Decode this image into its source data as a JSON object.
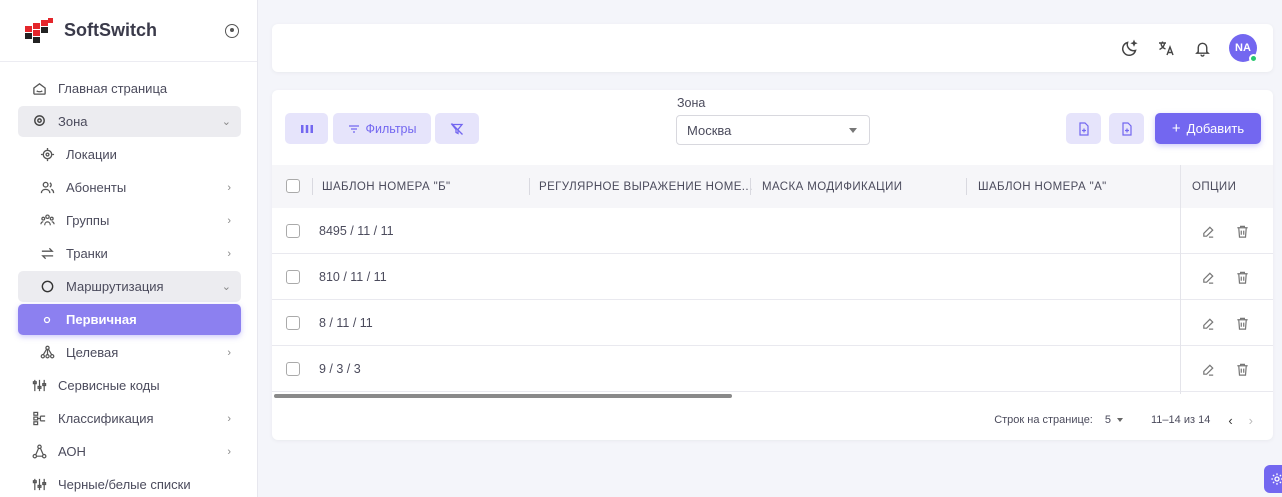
{
  "brand": {
    "name": "SoftSwitch"
  },
  "sidebar": {
    "items": [
      {
        "label": "Главная страница",
        "icon": "home-icon"
      },
      {
        "label": "Зона",
        "icon": "location-pin-icon",
        "expanded": true
      },
      {
        "label": "Локации",
        "icon": "target-icon"
      },
      {
        "label": "Абоненты",
        "icon": "users-icon"
      },
      {
        "label": "Группы",
        "icon": "group-icon"
      },
      {
        "label": "Транки",
        "icon": "arrows-exchange-icon"
      },
      {
        "label": "Маршрутизация",
        "icon": "circle-icon",
        "expanded": true
      },
      {
        "label": "Первичная",
        "icon": "dot-icon",
        "active": true
      },
      {
        "label": "Целевая",
        "icon": "sitemap-icon"
      },
      {
        "label": "Сервисные коды",
        "icon": "sliders-icon"
      },
      {
        "label": "Классификация",
        "icon": "hierarchy-icon"
      },
      {
        "label": "АОН",
        "icon": "network-icon"
      },
      {
        "label": "Черные/белые списки",
        "icon": "sliders-icon"
      }
    ]
  },
  "topbar": {
    "avatar_initials": "NA",
    "accent": "#7367f0",
    "online_color": "#28c76f"
  },
  "toolbar": {
    "filters_label": "Фильтры",
    "zone_label": "Зона",
    "zone_value": "Москва",
    "add_label": "Добавить"
  },
  "table": {
    "columns": [
      "ШАБЛОН НОМЕРА \"Б\"",
      "РЕГУЛЯРНОЕ ВЫРАЖЕНИЕ НОМЕ...",
      "МАСКА МОДИФИКАЦИИ",
      "ШАБЛОН НОМЕРА \"А\"",
      "ОПЦИИ"
    ],
    "rows": [
      {
        "pattern_b": "8495 / 11 / 11"
      },
      {
        "pattern_b": "810 / 11 / 11"
      },
      {
        "pattern_b": "8 / 11 / 11"
      },
      {
        "pattern_b": "9 / 3 / 3"
      }
    ]
  },
  "pager": {
    "rows_per_page_label": "Строк на странице:",
    "rows_per_page": "5",
    "range": "11–14 из 14"
  }
}
